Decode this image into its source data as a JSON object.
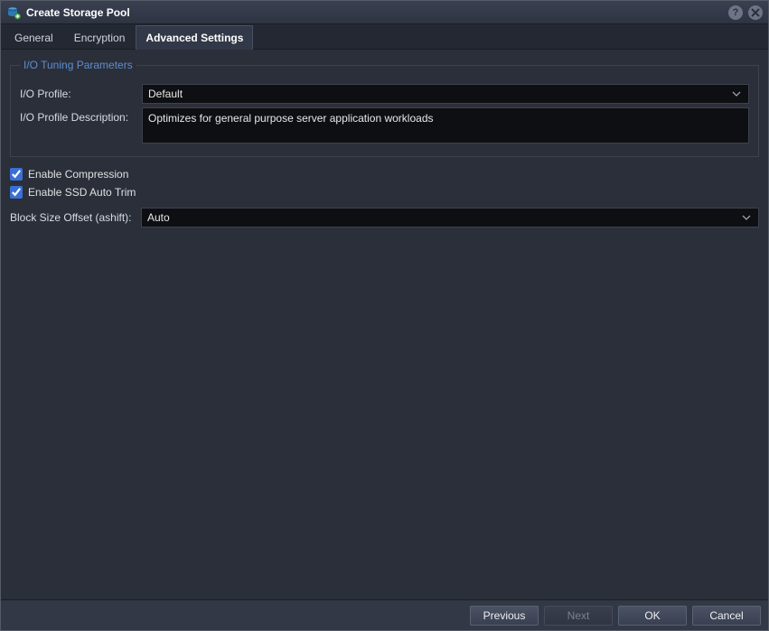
{
  "window": {
    "title": "Create Storage Pool"
  },
  "tabs": [
    {
      "label": "General",
      "active": false
    },
    {
      "label": "Encryption",
      "active": false
    },
    {
      "label": "Advanced Settings",
      "active": true
    }
  ],
  "group": {
    "legend": "I/O Tuning Parameters",
    "io_profile_label": "I/O Profile:",
    "io_profile_value": "Default",
    "io_profile_desc_label": "I/O Profile Description:",
    "io_profile_desc_value": "Optimizes for general purpose server application workloads"
  },
  "checks": {
    "compression_label": "Enable Compression",
    "compression_checked": true,
    "trim_label": "Enable SSD Auto Trim",
    "trim_checked": true
  },
  "ashift": {
    "label": "Block Size Offset (ashift):",
    "value": "Auto"
  },
  "footer": {
    "previous": "Previous",
    "next": "Next",
    "ok": "OK",
    "cancel": "Cancel"
  }
}
